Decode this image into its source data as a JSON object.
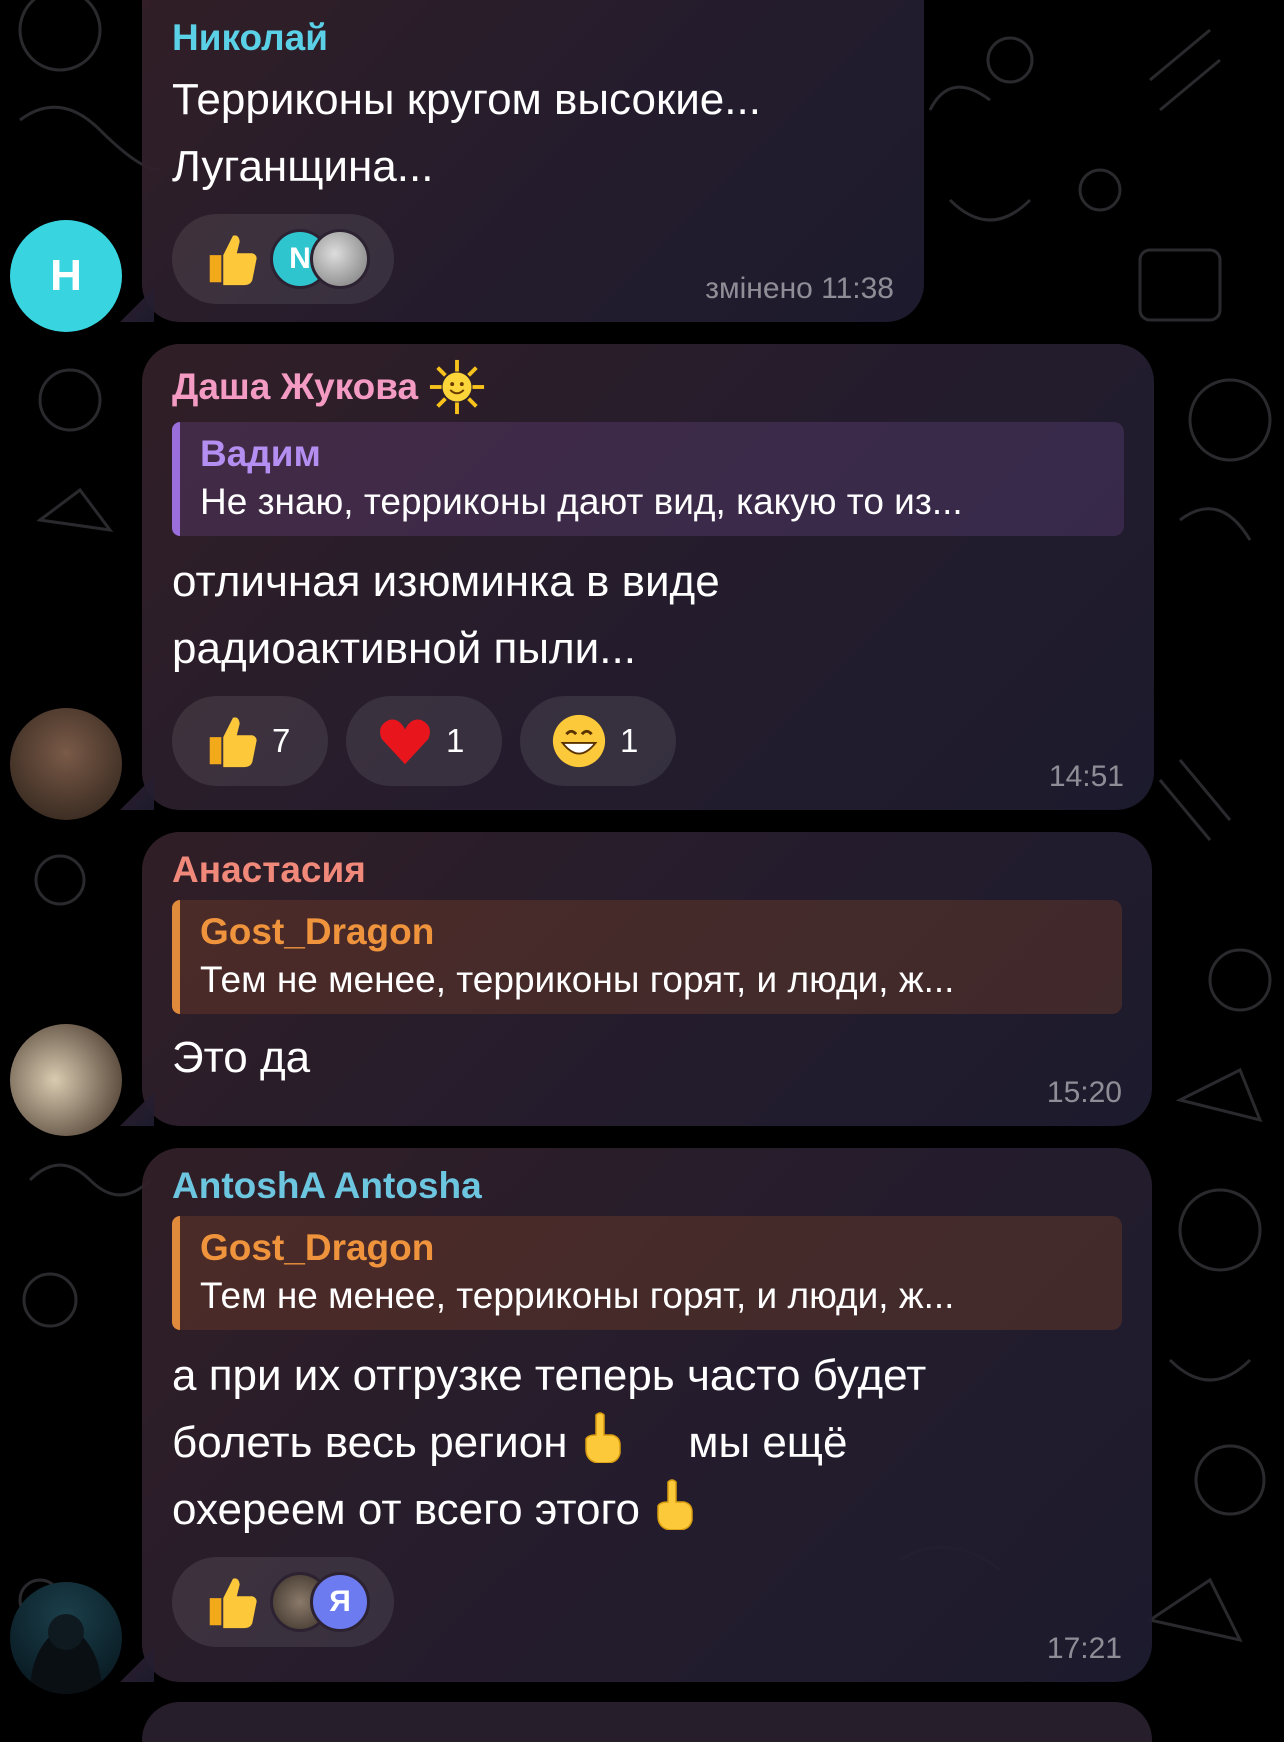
{
  "colors": {
    "nikolai": "#5ad1e6",
    "dasha": "#f39bc2",
    "vadim": "#b48ef0",
    "anastasia": "#f0897a",
    "gost": "#ef943c",
    "antosha": "#6cc6e0"
  },
  "messages": [
    {
      "sender": "Николай",
      "text_lines": [
        "Терриконы кругом высокие...",
        "Луганщина..."
      ],
      "avatar_letter": "Н",
      "reaction_mini_avatar": "N",
      "time": "змінено 11:38"
    },
    {
      "sender": "Даша Жукова",
      "sender_emoji": "sun-emoji",
      "reply_name": "Вадим",
      "reply_text": "Не знаю, терриконы дают вид, какую то из...",
      "text_lines": [
        "отличная изюминка в виде",
        "радиоактивной пыли..."
      ],
      "reactions": [
        {
          "emoji": "thumbs-up",
          "count": "7"
        },
        {
          "emoji": "heart",
          "count": "1"
        },
        {
          "emoji": "grin",
          "count": "1"
        }
      ],
      "time": "14:51"
    },
    {
      "sender": "Анастасия",
      "reply_name": "Gost_Dragon",
      "reply_text": "Тем не менее, терриконы горят, и люди, ж...",
      "text": "Это да",
      "time": "15:20"
    },
    {
      "sender": "AntoshA Antosha",
      "reply_name": "Gost_Dragon",
      "reply_text": "Тем не менее, терриконы горят, и люди, ж...",
      "text_line1": "а при их отгрузке теперь часто будет",
      "text_line2a": "болеть весь регион",
      "text_line2b": "мы ещё",
      "text_line3": "охереем от всего этого",
      "reaction_mini_avatar": "Я",
      "time": "17:21"
    }
  ]
}
